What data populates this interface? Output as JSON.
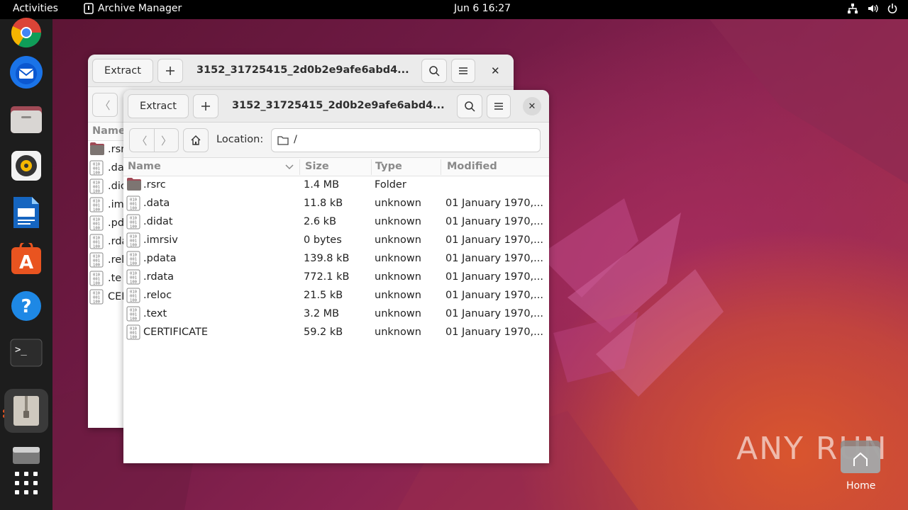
{
  "topbar": {
    "activities": "Activities",
    "app_name": "Archive Manager",
    "clock": "Jun 6  16:27"
  },
  "dock": {
    "items": [
      "chrome-icon",
      "thunderbird-icon",
      "files-icon",
      "rhythmbox-icon",
      "writer-icon",
      "software-icon",
      "help-icon",
      "terminal-icon",
      "archive-manager-icon",
      "drive-icon",
      "show-apps-icon"
    ]
  },
  "back_window": {
    "extract_label": "Extract",
    "title": "3152_31725415_2d0b2e9afe6abd4...",
    "col_name": "Name",
    "rows": [
      ".rsr",
      ".da",
      ".dic",
      ".im",
      ".pd",
      ".rda",
      ".rel",
      ".te",
      "CEF"
    ]
  },
  "front_window": {
    "extract_label": "Extract",
    "title": "3152_31725415_2d0b2e9afe6abd4...",
    "location_label": "Location:",
    "location_value": "/",
    "columns": {
      "name": "Name",
      "size": "Size",
      "type": "Type",
      "modified": "Modified"
    },
    "rows": [
      {
        "name": ".rsrc",
        "size": "1.4 MB",
        "type": "Folder",
        "modified": "",
        "kind": "folder"
      },
      {
        "name": ".data",
        "size": "11.8 kB",
        "type": "unknown",
        "modified": "01 January 1970,...",
        "kind": "binary"
      },
      {
        "name": ".didat",
        "size": "2.6 kB",
        "type": "unknown",
        "modified": "01 January 1970,...",
        "kind": "binary"
      },
      {
        "name": ".imrsiv",
        "size": "0 bytes",
        "type": "unknown",
        "modified": "01 January 1970,...",
        "kind": "binary"
      },
      {
        "name": ".pdata",
        "size": "139.8 kB",
        "type": "unknown",
        "modified": "01 January 1970,...",
        "kind": "binary"
      },
      {
        "name": ".rdata",
        "size": "772.1 kB",
        "type": "unknown",
        "modified": "01 January 1970,...",
        "kind": "binary"
      },
      {
        "name": ".reloc",
        "size": "21.5 kB",
        "type": "unknown",
        "modified": "01 January 1970,...",
        "kind": "binary"
      },
      {
        "name": ".text",
        "size": "3.2 MB",
        "type": "unknown",
        "modified": "01 January 1970,...",
        "kind": "binary"
      },
      {
        "name": "CERTIFICATE",
        "size": "59.2 kB",
        "type": "unknown",
        "modified": "01 January 1970,...",
        "kind": "binary"
      }
    ]
  },
  "desktop": {
    "watermark": "ANY RUN",
    "home_label": "Home"
  },
  "colors": {
    "accent": "#e95420",
    "topbar": "#000000",
    "dock": "#1d1d1d",
    "folder": "#7a6a6a"
  }
}
